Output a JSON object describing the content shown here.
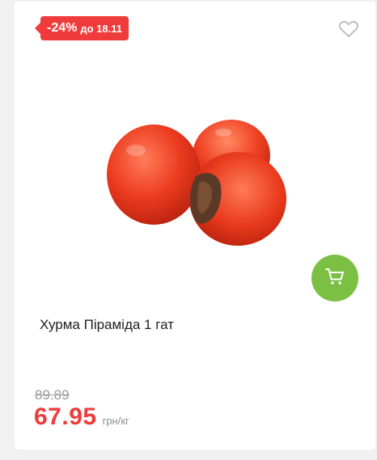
{
  "badge": {
    "discount": "-24%",
    "until": "до 18.11"
  },
  "product": {
    "title": "Хурма Піраміда 1 гат",
    "image_icon": "persimmon-image",
    "old_price": "89.89",
    "price": "67.95",
    "unit": "грн/кг"
  },
  "icons": {
    "favorite": "heart-icon",
    "cart": "cart-icon"
  },
  "colors": {
    "accent_red": "#ef3b3b",
    "cart_green": "#7bc043",
    "card_bg": "#ffffff",
    "page_bg": "#f1f1f1"
  }
}
